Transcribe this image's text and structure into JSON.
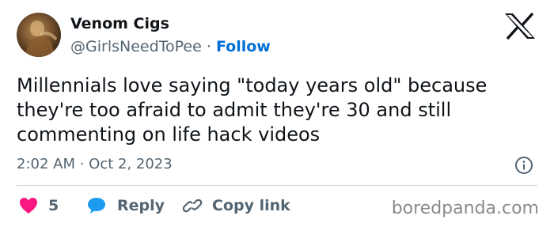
{
  "author": {
    "name": "Venom Cigs",
    "handle": "@GirlsNeedToPee",
    "separator": "·",
    "follow_label": "Follow"
  },
  "tweet": {
    "text": "Millennials love saying \"today years old\" because they're too afraid to admit they're 30 and still commenting on life hack videos",
    "timestamp": "2:02 AM · Oct 2, 2023"
  },
  "actions": {
    "like_count": "5",
    "reply_label": "Reply",
    "copy_link_label": "Copy link"
  },
  "watermark": "boredpanda.com",
  "icons": [
    "x-logo-icon",
    "info-icon",
    "heart-icon",
    "reply-bubble-icon",
    "link-icon"
  ],
  "colors": {
    "text": "#0f1419",
    "secondary": "#536471",
    "follow": "#006fd6",
    "like": "#f91880",
    "reply": "#1d9bf0",
    "divider": "#cfd9de"
  }
}
